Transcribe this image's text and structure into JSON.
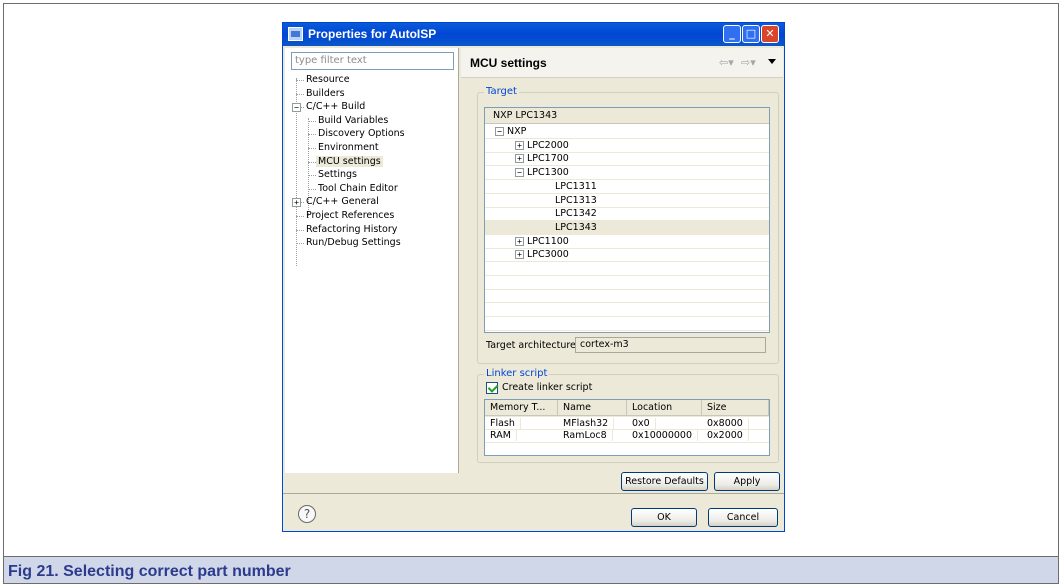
{
  "window": {
    "title": "Properties for AutoISP"
  },
  "left_panel": {
    "filter_placeholder": "type filter text",
    "items": [
      {
        "label": "Resource"
      },
      {
        "label": "Builders"
      },
      {
        "label": "C/C++ Build",
        "expanded": true
      },
      {
        "label": "Build Variables"
      },
      {
        "label": "Discovery Options"
      },
      {
        "label": "Environment"
      },
      {
        "label": "MCU settings",
        "selected": true
      },
      {
        "label": "Settings"
      },
      {
        "label": "Tool Chain Editor"
      },
      {
        "label": "C/C++ General",
        "expanded": false
      },
      {
        "label": "Project References"
      },
      {
        "label": "Refactoring History"
      },
      {
        "label": "Run/Debug Settings"
      }
    ]
  },
  "right_panel": {
    "title": "MCU settings",
    "target": {
      "group_label": "Target",
      "header": "NXP LPC1343",
      "tree": [
        {
          "label": "NXP",
          "level": 0,
          "expander": "-"
        },
        {
          "label": "LPC2000",
          "level": 1,
          "expander": "+"
        },
        {
          "label": "LPC1700",
          "level": 1,
          "expander": "+"
        },
        {
          "label": "LPC1300",
          "level": 1,
          "expander": "-"
        },
        {
          "label": "LPC1311",
          "level": 2
        },
        {
          "label": "LPC1313",
          "level": 2
        },
        {
          "label": "LPC1342",
          "level": 2
        },
        {
          "label": "LPC1343",
          "level": 2,
          "selected": true
        },
        {
          "label": "LPC1100",
          "level": 1,
          "expander": "+"
        },
        {
          "label": "LPC3000",
          "level": 1,
          "expander": "+"
        }
      ],
      "architecture_label": "Target architecture",
      "architecture_value": "cortex-m3"
    },
    "linker": {
      "group_label": "Linker script",
      "create_label": "Create linker script",
      "create_checked": true,
      "columns": [
        "Memory T...",
        "Name",
        "Location",
        "Size"
      ],
      "rows": [
        [
          "Flash",
          "MFlash32",
          "0x0",
          "0x8000"
        ],
        [
          "RAM",
          "RamLoc8",
          "0x10000000",
          "0x2000"
        ]
      ]
    },
    "restore_defaults_label": "Restore Defaults",
    "apply_label": "Apply"
  },
  "footer": {
    "ok_label": "OK",
    "cancel_label": "Cancel"
  },
  "caption": "Fig 21.   Selecting correct part number"
}
